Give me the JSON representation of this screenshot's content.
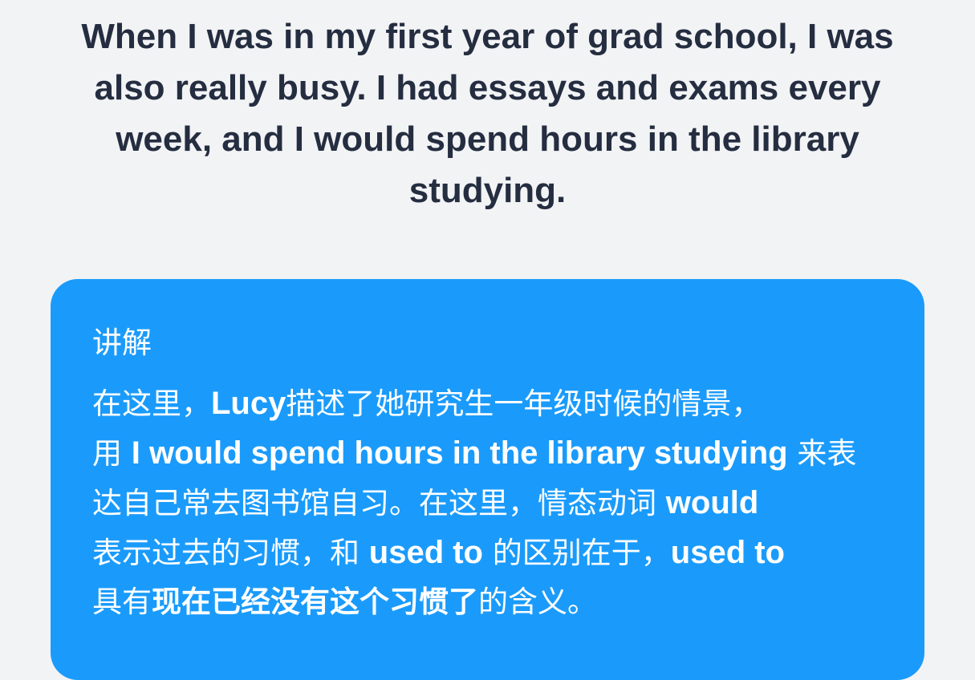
{
  "sentence": {
    "line1": "When I was in my first year of grad school, I was",
    "line2": "also really busy. I had essays and exams every",
    "line3": "week, and I would spend hours in the library",
    "line4": "studying."
  },
  "explanation": {
    "title": "讲解",
    "lines": [
      [
        {
          "text": "在这里，",
          "style": "normal"
        },
        {
          "text": "Lucy",
          "style": "hl"
        },
        {
          "text": "描述了她研究生一年级时候的情景，",
          "style": "normal"
        }
      ],
      [
        {
          "text": "用 ",
          "style": "normal"
        },
        {
          "text": "I would spend hours in the library studying",
          "style": "hl"
        },
        {
          "text": " 来表",
          "style": "normal"
        }
      ],
      [
        {
          "text": "达自己常去图书馆自习。在这里，情态动词 ",
          "style": "normal"
        },
        {
          "text": "would",
          "style": "hl"
        }
      ],
      [
        {
          "text": "表示过去的习惯，和 ",
          "style": "normal"
        },
        {
          "text": "used to",
          "style": "hl"
        },
        {
          "text": " 的区别在于，",
          "style": "normal"
        },
        {
          "text": "used to",
          "style": "hl"
        }
      ],
      [
        {
          "text": "具有",
          "style": "normal"
        },
        {
          "text": "现在已经没有这个习惯了",
          "style": "hl-cn"
        },
        {
          "text": "的含义。",
          "style": "normal"
        }
      ]
    ]
  },
  "colors": {
    "background": "#f2f3f5",
    "sentence_text": "#252d40",
    "card_background": "#1a9bfb",
    "card_text": "#ffffff"
  }
}
